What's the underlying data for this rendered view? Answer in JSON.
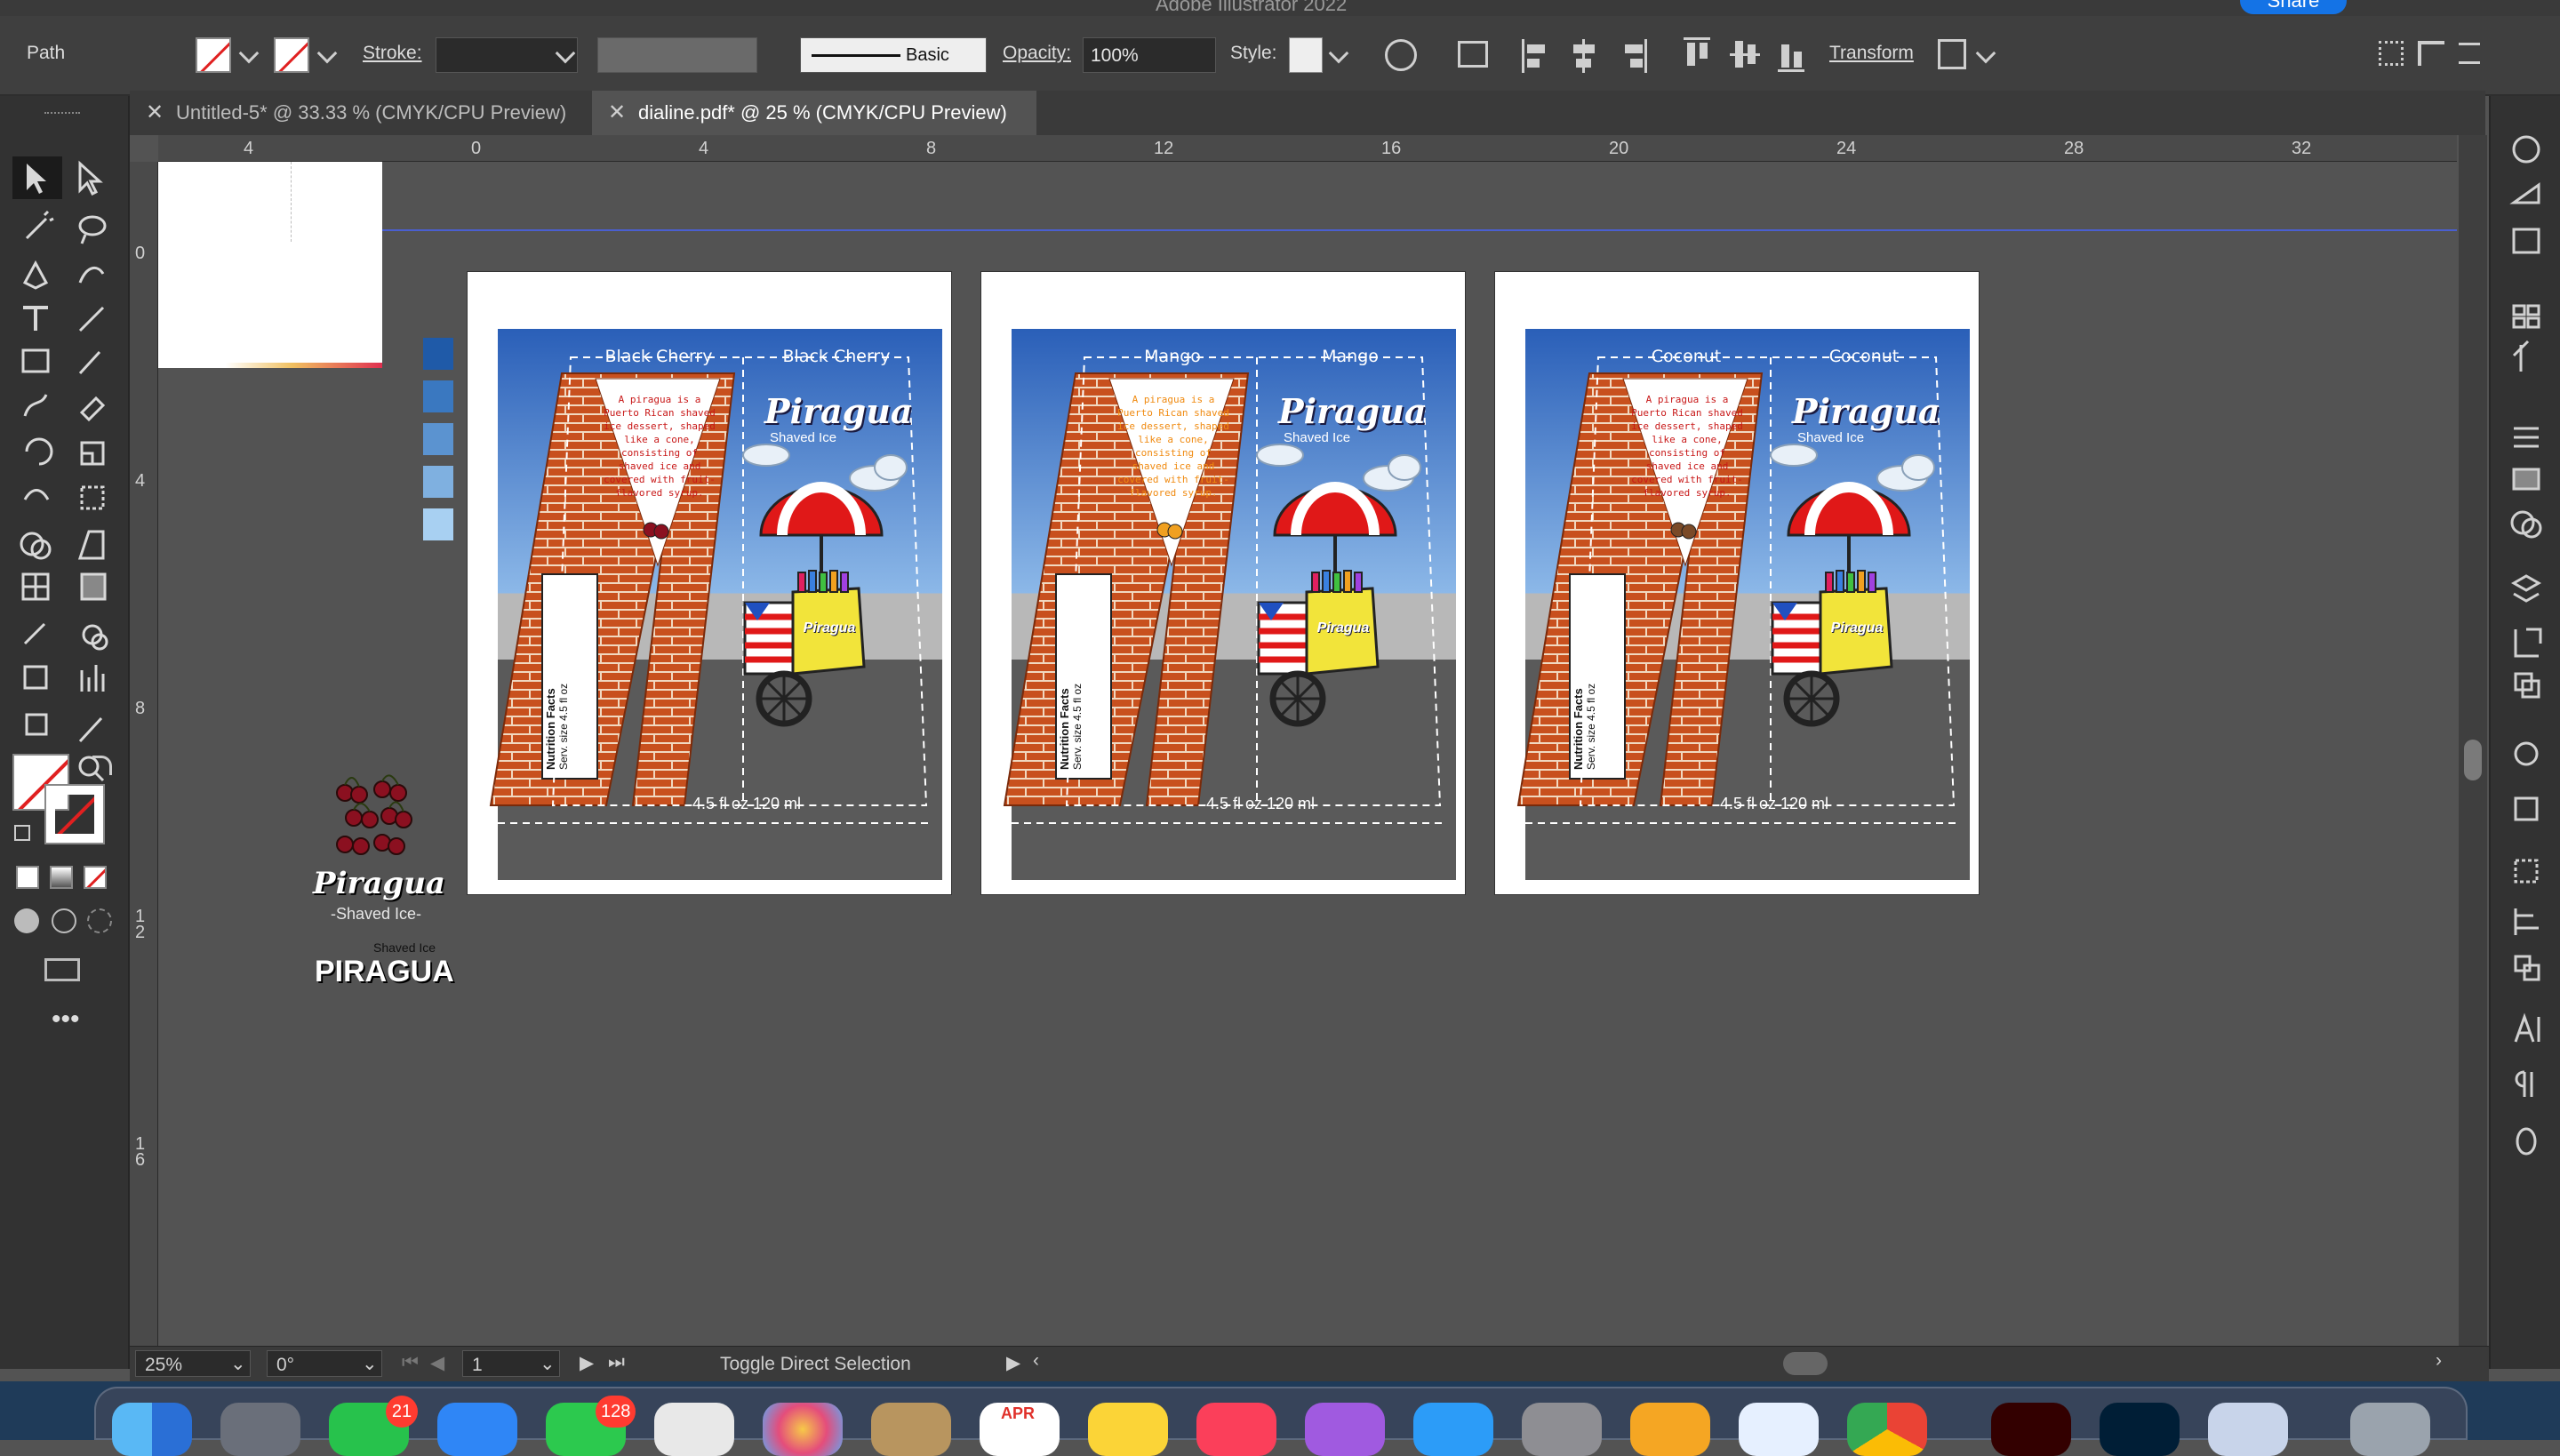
{
  "app": {
    "window_title": "Adobe Illustrator 2022",
    "share_label": "Share"
  },
  "controlbar": {
    "selection_type": "Path",
    "stroke_label": "Stroke:",
    "brush_label": "Basic",
    "opacity_label": "Opacity:",
    "opacity_value": "100%",
    "style_label": "Style:",
    "transform_label": "Transform"
  },
  "tabs": [
    {
      "label": "Untitled-5* @ 33.33 % (CMYK/CPU Preview)",
      "active": false
    },
    {
      "label": "dialine.pdf* @ 25 % (CMYK/CPU Preview)",
      "active": true
    }
  ],
  "ruler": {
    "h_ticks": [
      "4",
      "0",
      "4",
      "8",
      "12",
      "16",
      "20",
      "24",
      "28",
      "32"
    ],
    "v_ticks": [
      "0",
      "4",
      "8",
      "12",
      "16"
    ]
  },
  "products": [
    {
      "flavor": "Black Cherry",
      "fruit": "cherry",
      "fruit_color": "#8b1020"
    },
    {
      "flavor": "Mango",
      "fruit": "mango",
      "fruit_color": "#f0a020"
    },
    {
      "flavor": "Coconut",
      "fruit": "coconut",
      "fruit_color": "#7a4a28"
    }
  ],
  "label": {
    "brand": "Piragua",
    "tagline": "Shaved Ice",
    "description": "A piragua is a Puerto Rican shaved ice dessert, shaped like a cone, consisting of shaved ice and covered with fruit-flavored syrup.",
    "volume": "4.5 fl oz 120 ml",
    "nutrition_title": "Nutrition Facts",
    "serving": "Serv. size 4.5 fl oz",
    "cart_sign": "Piragua"
  },
  "canvas_assets": {
    "logo_script": "Piragua",
    "logo_sub": "-Shaved Ice-",
    "logo_small": "Shaved Ice",
    "logo_caps": "PIRAGUA",
    "swatches": [
      "#1f5aa8",
      "#3a78c0",
      "#5b93d0",
      "#7fb0e0",
      "#a8d0f2"
    ]
  },
  "statusbar": {
    "zoom": "25%",
    "rotation": "0°",
    "artboard_number": "1",
    "status_text": "Toggle Direct Selection"
  },
  "dock": {
    "facetime_badge": "21",
    "messages_badge": "128",
    "calendar_month": "APR"
  }
}
